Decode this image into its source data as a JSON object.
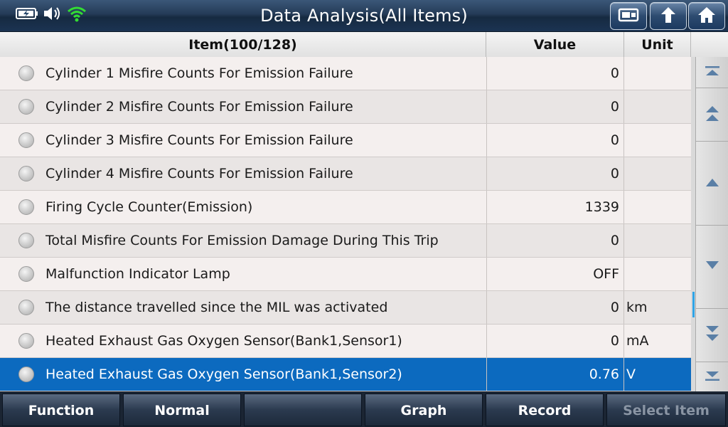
{
  "header": {
    "title": "Data Analysis(All Items)",
    "status_icons": [
      "battery-charging-icon",
      "speaker-icon",
      "wifi-icon"
    ],
    "buttons": [
      "screenshot-icon",
      "back-up-arrow-icon",
      "home-icon"
    ]
  },
  "table": {
    "columns": {
      "item": "Item(100/128)",
      "value": "Value",
      "unit": "Unit"
    },
    "rows": [
      {
        "name": "Cylinder 1 Misfire Counts For Emission Failure",
        "value": "0",
        "unit": ""
      },
      {
        "name": "Cylinder 2 Misfire Counts For Emission Failure",
        "value": "0",
        "unit": ""
      },
      {
        "name": "Cylinder 3 Misfire Counts For Emission Failure",
        "value": "0",
        "unit": ""
      },
      {
        "name": "Cylinder 4 Misfire Counts For Emission Failure",
        "value": "0",
        "unit": ""
      },
      {
        "name": "Firing Cycle Counter(Emission)",
        "value": "1339",
        "unit": ""
      },
      {
        "name": "Total Misfire Counts For Emission Damage During This Trip",
        "value": "0",
        "unit": ""
      },
      {
        "name": "Malfunction Indicator Lamp",
        "value": "OFF",
        "unit": ""
      },
      {
        "name": "The distance travelled since the MIL was activated",
        "value": "0",
        "unit": "km"
      },
      {
        "name": "Heated Exhaust Gas Oxygen Sensor(Bank1,Sensor1)",
        "value": "0",
        "unit": "mA"
      },
      {
        "name": "Heated Exhaust Gas Oxygen Sensor(Bank1,Sensor2)",
        "value": "0.76",
        "unit": "V"
      }
    ],
    "selected_row": 10
  },
  "scroll_buttons": [
    "scroll-top-icon",
    "page-up-icon",
    "line-up-icon",
    "line-down-icon",
    "page-down-icon",
    "scroll-bottom-icon"
  ],
  "footer": {
    "function": "Function",
    "normal": "Normal",
    "empty": "",
    "graph": "Graph",
    "record": "Record",
    "select_item": "Select Item"
  },
  "colors": {
    "accent": "#0c6abf",
    "wifi": "#33dd33",
    "scroll_thumb": "#2fa4e7"
  }
}
